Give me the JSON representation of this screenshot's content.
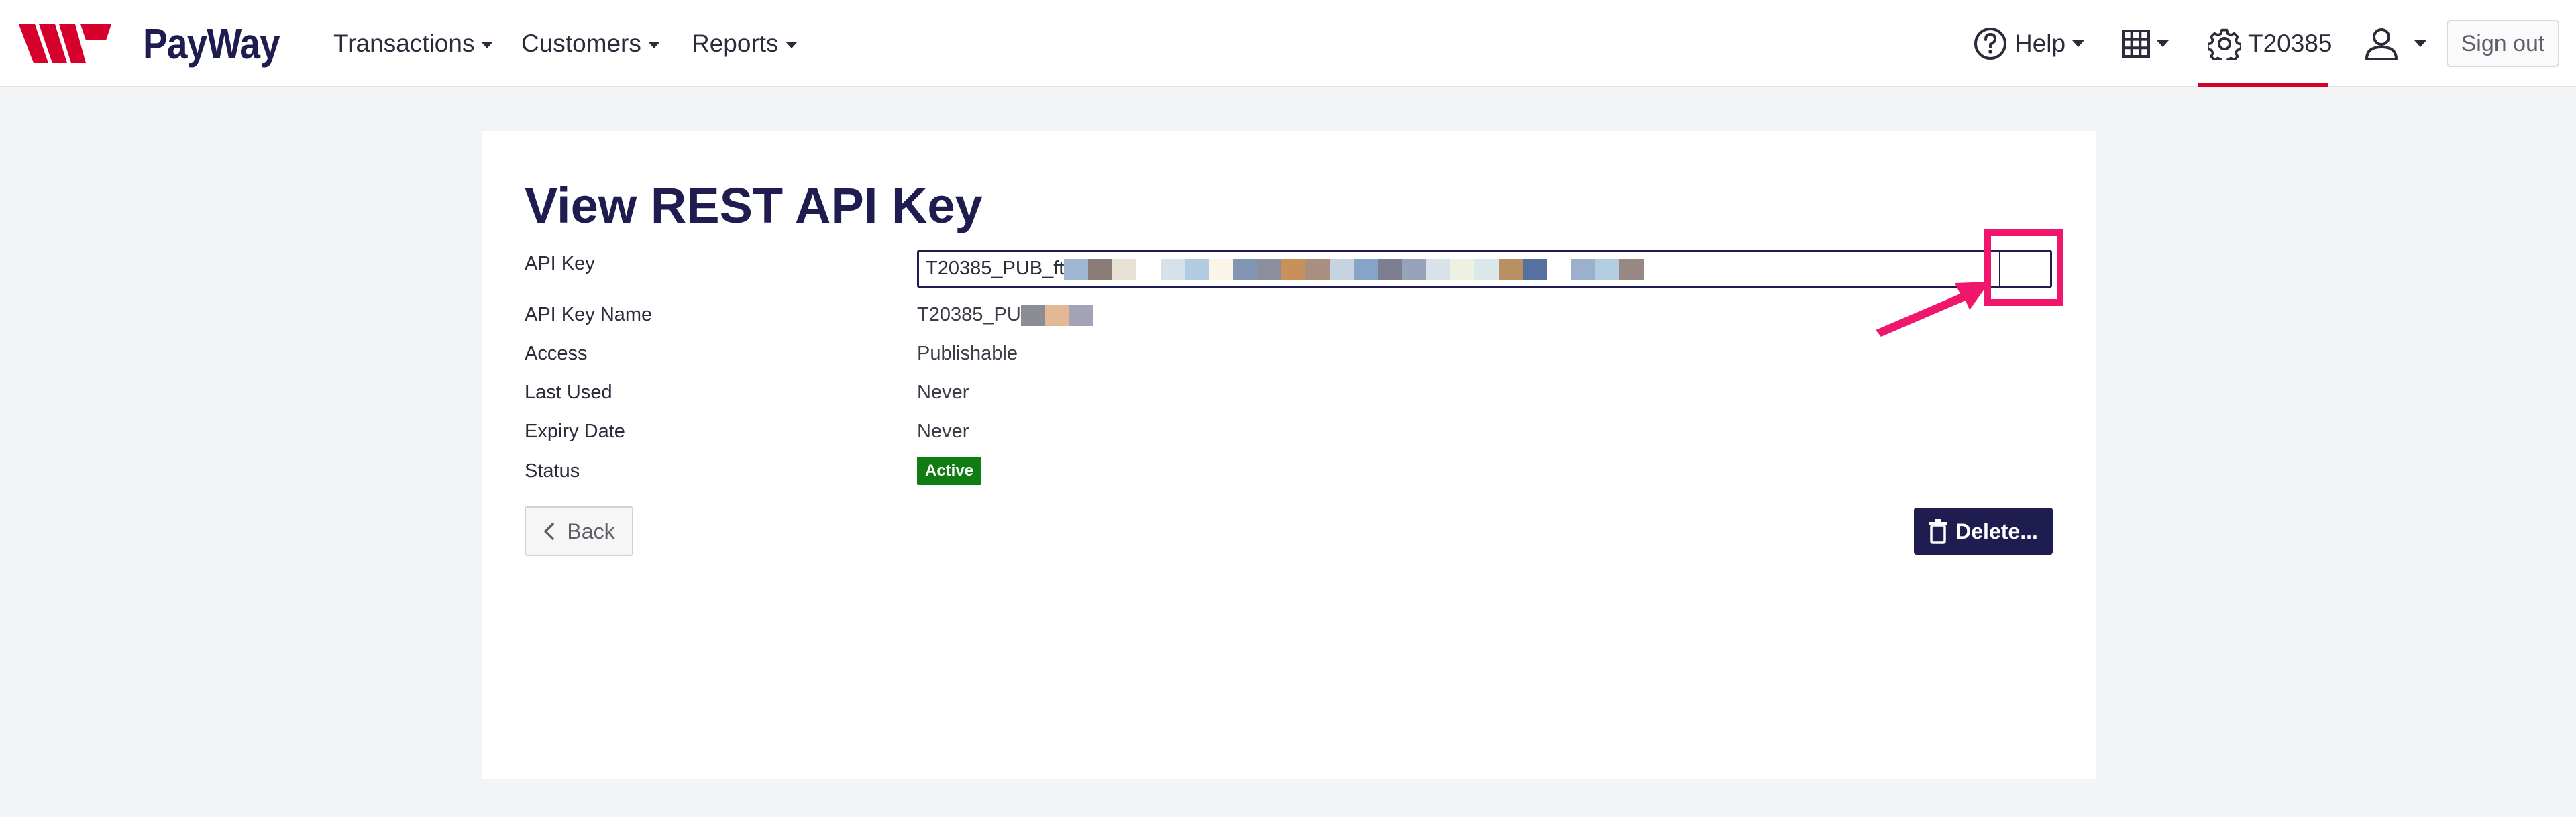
{
  "brand": {
    "name": "PayWay"
  },
  "nav": {
    "menus": [
      {
        "label": "Transactions"
      },
      {
        "label": "Customers"
      },
      {
        "label": "Reports"
      }
    ],
    "help_label": "Help",
    "merchant_label": "T20385",
    "sign_out_label": "Sign out"
  },
  "page": {
    "title": "View REST API Key",
    "fields": {
      "api_key": {
        "label": "API Key",
        "value_visible": "T20385_PUB_ft"
      },
      "api_key_name": {
        "label": "API Key Name",
        "value_visible": "T20385_PU"
      },
      "access": {
        "label": "Access",
        "value": "Publishable"
      },
      "last_used": {
        "label": "Last Used",
        "value": "Never"
      },
      "expiry_date": {
        "label": "Expiry Date",
        "value": "Never"
      },
      "status": {
        "label": "Status",
        "value": "Active"
      }
    },
    "back_label": "Back",
    "delete_label": "Delete..."
  },
  "colors": {
    "brand_navy": "#1f1c4f",
    "brand_red": "#d5002b",
    "status_green": "#0f7d12",
    "annotation_pink": "#f0166b"
  },
  "redaction_colors": {
    "api_key": [
      "#9fb7d3",
      "#8a7d78",
      "#e6e1d3",
      "#ffffff",
      "#d6e1ea",
      "#b3cbe0",
      "#fbf5e8",
      "#8295b5",
      "#8a8f9b",
      "#c8915a",
      "#a88f80",
      "#c6d4e1",
      "#86a5c6",
      "#7d7f91",
      "#96a3b8",
      "#d9e2e8",
      "#edf1e0",
      "#dbe8eb",
      "#b99064",
      "#5670a0",
      "#ffffff",
      "#9cafcc",
      "#b2cce0",
      "#988883"
    ],
    "api_key_name": [
      "#8c8c94",
      "#e2b895",
      "#a3a3b5"
    ]
  },
  "icons": {
    "logo": "westpac-w-logo",
    "help": "question-circle-icon",
    "apps": "grid-icon",
    "settings": "gear-icon",
    "user": "user-icon",
    "back": "chevron-left-icon",
    "delete": "trash-icon",
    "annotation": "arrow-annotation"
  }
}
